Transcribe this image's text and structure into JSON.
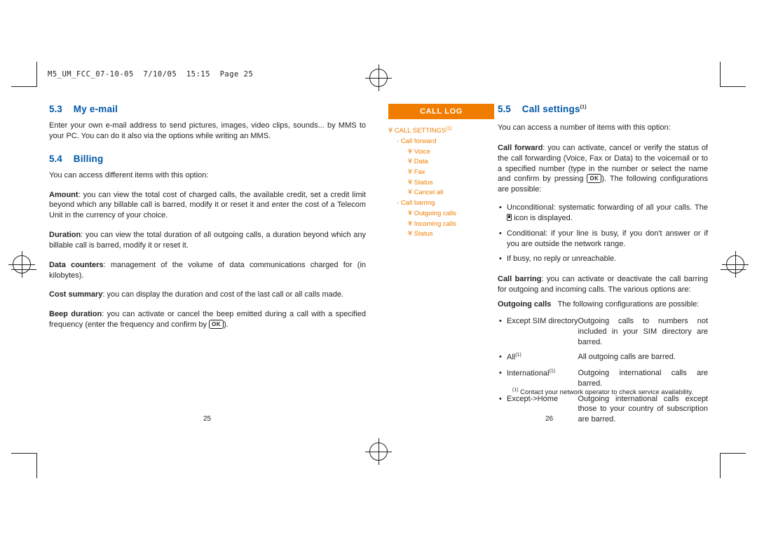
{
  "slug": "M5_UM_FCC_07-10-05  7/10/05  15:15  Page 25",
  "left_column": {
    "sections": [
      {
        "num": "5.3",
        "title": "My e-mail",
        "paragraphs": [
          "Enter your own e-mail address to send pictures, images, video clips, sounds... by MMS to your PC. You can do it also via the options while writing an MMS."
        ]
      },
      {
        "num": "5.4",
        "title": "Billing",
        "intro": "You can access different items with this option:",
        "items": [
          {
            "term": "Amount",
            "text": ": you can view the total cost of charged calls, the available credit, set a credit limit beyond which any billable call is barred, modify it or reset it and enter the cost of a Telecom Unit in the currency of your choice."
          },
          {
            "term": "Duration",
            "text": ": you can view the total duration of all outgoing calls, a duration beyond which any billable call is barred, modify it or reset it."
          },
          {
            "term": "Data counters",
            "text": ": management of the volume of data communications charged for (in kilobytes)."
          },
          {
            "term": "Cost summary",
            "text": ": you can display the duration and cost of the last call or all calls made."
          },
          {
            "term": "Beep duration",
            "text": ": you can activate or cancel the beep emitted during a call with a specified frequency (enter the frequency and confirm by",
            "key": "OK",
            "tail": ")."
          }
        ]
      }
    ]
  },
  "call_log_box": {
    "header": "CALL LOG",
    "tree": [
      {
        "level": 0,
        "marker": "arrow",
        "label": "CALL SETTINGS",
        "sup": "(1)"
      },
      {
        "level": 1,
        "marker": "dash",
        "label": "Call forward"
      },
      {
        "level": 2,
        "marker": "arrow",
        "label": "Voice"
      },
      {
        "level": 2,
        "marker": "arrow",
        "label": "Data"
      },
      {
        "level": 2,
        "marker": "arrow",
        "label": "Fax"
      },
      {
        "level": 2,
        "marker": "arrow",
        "label": "Status"
      },
      {
        "level": 2,
        "marker": "arrow",
        "label": "Cancel all"
      },
      {
        "level": 1,
        "marker": "dash",
        "label": "Call barring"
      },
      {
        "level": 2,
        "marker": "arrow",
        "label": "Outgoing calls"
      },
      {
        "level": 2,
        "marker": "arrow",
        "label": "Incoming calls"
      },
      {
        "level": 2,
        "marker": "arrow",
        "label": "Status"
      }
    ]
  },
  "right_column": {
    "section": {
      "num": "5.5",
      "title": "Call settings",
      "sup": "(1)"
    },
    "intro": "You can access a number of items with this option:",
    "call_forward": {
      "term": "Call forward",
      "text_1": ": you can activate, cancel or verify the status of the call forwarding (Voice, Fax or Data) to the voicemail or to a specified number (type in the number or select the name and confirm by pressing",
      "key": "OK",
      "text_2": "). The following configurations are possible:",
      "bullets": [
        {
          "text_1": "Unconditional: systematic forwarding of all your calls. The",
          "icon": "call-forward-icon",
          "text_2": "icon is displayed."
        },
        {
          "text_1": "Conditional: if your line is busy, if you don't answer or if you are outside the network range."
        },
        {
          "text_1": "If busy, no reply or unreachable."
        }
      ]
    },
    "call_barring": {
      "term": "Call barring",
      "text": ": you can activate or deactivate the call barring for outgoing and incoming calls. The various options are:",
      "subhead": "Outgoing calls",
      "subhead_note": "The following configurations are possible:",
      "rows": [
        {
          "key": "Except SIM directory",
          "value": "Outgoing calls to numbers not included in your SIM directory are barred."
        },
        {
          "key": "All",
          "key_sup": "(1)",
          "value": "All outgoing calls are barred."
        },
        {
          "key": "International",
          "key_sup": "(1)",
          "value": "Outgoing international calls are barred."
        },
        {
          "key": "Except->Home",
          "value": "Outgoing international calls except those to your country of subscription are barred."
        }
      ]
    },
    "footnote": {
      "sup": "(1)",
      "text": "Contact your network operator to check service availability."
    }
  },
  "page_numbers": {
    "left": "25",
    "right": "26"
  }
}
